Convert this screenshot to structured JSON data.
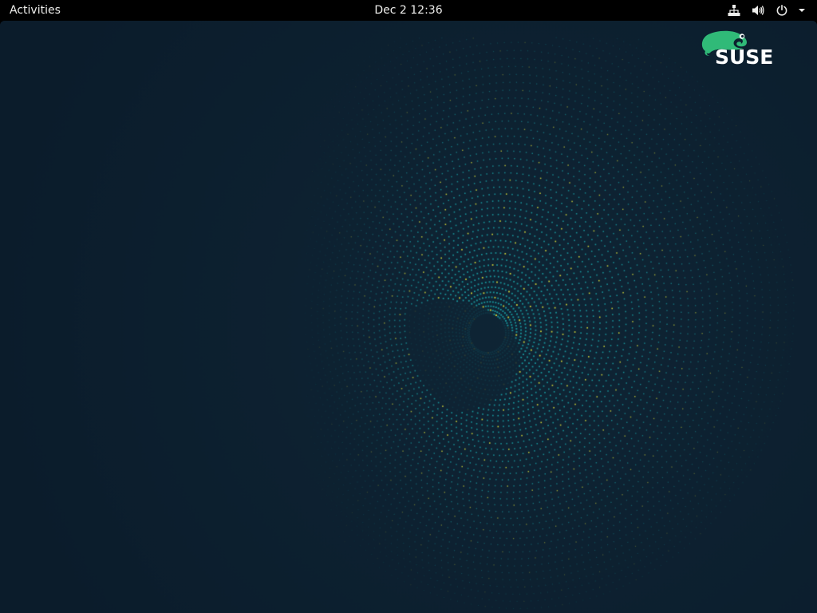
{
  "topbar": {
    "activities_label": "Activities",
    "clock": "Dec 2  12:36",
    "tray": {
      "network_icon": "network-wired-icon",
      "volume_icon": "volume-icon",
      "power_icon": "power-icon",
      "menu_icon": "chevron-down-icon"
    }
  },
  "desktop": {
    "wallpaper": "suse-dotted-swirl-wallpaper",
    "logo": {
      "text": "SUSE",
      "icon": "chameleon-icon",
      "color": "#30ba78"
    }
  },
  "colors": {
    "topbar_bg": "#000000",
    "desktop_bg": "#0d1e2d",
    "dot_teal": "#1aa3a8",
    "dot_yellow": "#d8dc3a",
    "logo_green": "#30ba78"
  }
}
